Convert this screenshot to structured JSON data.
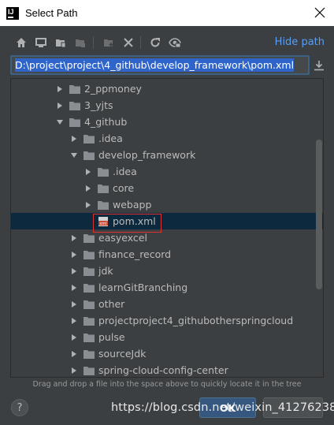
{
  "window": {
    "title": "Select Path",
    "app_logo": "IJ"
  },
  "toolbar": {
    "icons": [
      "home-icon",
      "desktop-icon",
      "project-icon",
      "module-icon",
      "new-folder-icon",
      "delete-icon",
      "refresh-icon",
      "show-hidden-icon"
    ],
    "hide_path_label": "Hide path"
  },
  "path": {
    "value": "D:\\project\\project\\4_github\\develop_framework\\pom.xml"
  },
  "tree": {
    "rows": [
      {
        "label": "2_ppmoney",
        "depth": 0,
        "expanded": false,
        "type": "folder"
      },
      {
        "label": "3_yjts",
        "depth": 0,
        "expanded": false,
        "type": "folder"
      },
      {
        "label": "4_github",
        "depth": 0,
        "expanded": true,
        "type": "folder"
      },
      {
        "label": ".idea",
        "depth": 1,
        "expanded": false,
        "type": "folder"
      },
      {
        "label": "develop_framework",
        "depth": 1,
        "expanded": true,
        "type": "folder"
      },
      {
        "label": ".idea",
        "depth": 2,
        "expanded": false,
        "type": "folder"
      },
      {
        "label": "core",
        "depth": 2,
        "expanded": false,
        "type": "folder"
      },
      {
        "label": "webapp",
        "depth": 2,
        "expanded": false,
        "type": "folder"
      },
      {
        "label": "pom.xml",
        "depth": 2,
        "type": "file",
        "selected": true
      },
      {
        "label": "easyexcel",
        "depth": 1,
        "expanded": false,
        "type": "folder"
      },
      {
        "label": "finance_record",
        "depth": 1,
        "expanded": false,
        "type": "folder"
      },
      {
        "label": "jdk",
        "depth": 1,
        "expanded": false,
        "type": "folder"
      },
      {
        "label": "learnGitBranching",
        "depth": 1,
        "expanded": false,
        "type": "folder"
      },
      {
        "label": "other",
        "depth": 1,
        "expanded": false,
        "type": "folder"
      },
      {
        "label": "projectproject4_githubotherspringcloud",
        "depth": 1,
        "expanded": false,
        "type": "folder"
      },
      {
        "label": "pulse",
        "depth": 1,
        "expanded": false,
        "type": "folder"
      },
      {
        "label": "sourceJdk",
        "depth": 1,
        "expanded": false,
        "type": "folder"
      },
      {
        "label": "spring-cloud-config-center",
        "depth": 1,
        "expanded": false,
        "type": "folder"
      }
    ]
  },
  "hint": "Drag and drop a file into the space above to quickly locate it in the tree",
  "footer": {
    "help_label": "?",
    "ok_label": "OK",
    "cancel_label": ""
  },
  "watermark": "https://blog.csdn.net/weixin_41276238",
  "colors": {
    "background": "#3c3f41",
    "selection": "#0d293e",
    "link": "#589df6",
    "folder": "#8a8e92",
    "highlight_border": "#e03030"
  }
}
